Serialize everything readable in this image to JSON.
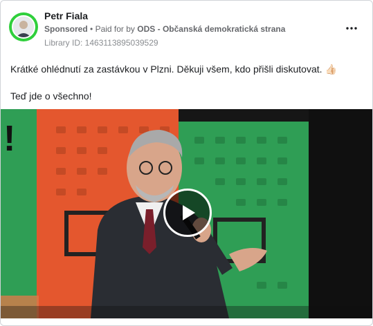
{
  "post": {
    "author": "Petr Fiala",
    "sponsored_label": "Sponsored",
    "separator": "•",
    "paid_for_prefix": "Paid for by",
    "payer": "ODS - Občanská demokratická strana",
    "library_id": "Library ID: 1463113895039529",
    "text_line1": "Krátké ohlédnutí za zastávkou v Plzni. Děkuji všem, kdo přišli diskutovat.",
    "emoji": "👍🏻",
    "text_line2": "Teď jde o všechno!"
  },
  "icons": {
    "more": "more-horizontal-icon",
    "play": "play-icon"
  },
  "colors": {
    "avatar_ring": "#2fcf3b",
    "poster_orange": "#e4572e",
    "poster_green": "#2f9e55"
  }
}
